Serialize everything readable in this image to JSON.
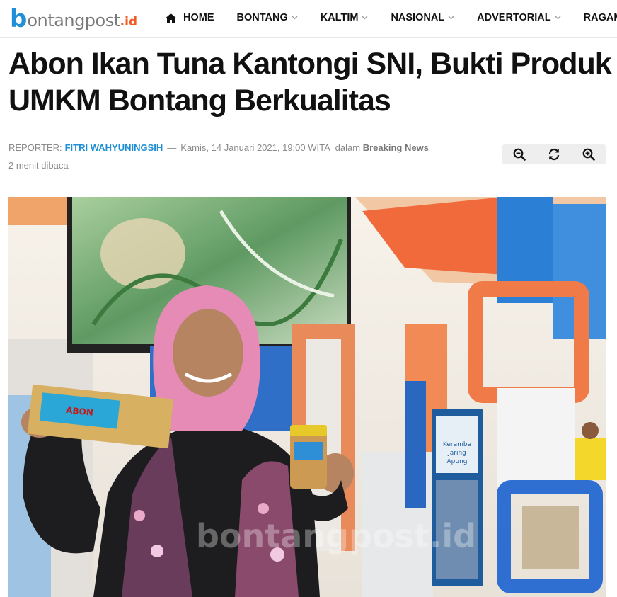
{
  "site": {
    "logo_b": "b",
    "logo_rest": "ontangpost",
    "logo_id": ".id"
  },
  "nav": {
    "items": [
      {
        "label": "HOME",
        "icon": "home-icon"
      },
      {
        "label": "BONTANG",
        "dropdown": true
      },
      {
        "label": "KALTIM",
        "dropdown": true
      },
      {
        "label": "NASIONAL",
        "dropdown": true
      },
      {
        "label": "ADVERTORIAL",
        "dropdown": true
      },
      {
        "label": "RAGAM"
      }
    ]
  },
  "article": {
    "title": "Abon Ikan Tuna Kantongi SNI, Bukti Produk UMKM Bontang Berkualitas",
    "reporter_label": "Reporter:",
    "author": "Fitri Wahyuningsih",
    "separator": "—",
    "date": "Kamis, 14 Januari 2021, 19:00 WITA",
    "in_label": "dalam",
    "category": "Breaking News",
    "read_time": "2 menit dibaca"
  },
  "tools": {
    "icons": [
      "zoom-out-icon",
      "reset-icon",
      "zoom-in-icon"
    ]
  },
  "image": {
    "watermark": "bontangpost.id",
    "packet_label": "ABON",
    "banner_text": "Keramba Jaring Apung"
  },
  "colors": {
    "brand_blue": "#1f8fd6",
    "brand_orange": "#f15a24"
  }
}
